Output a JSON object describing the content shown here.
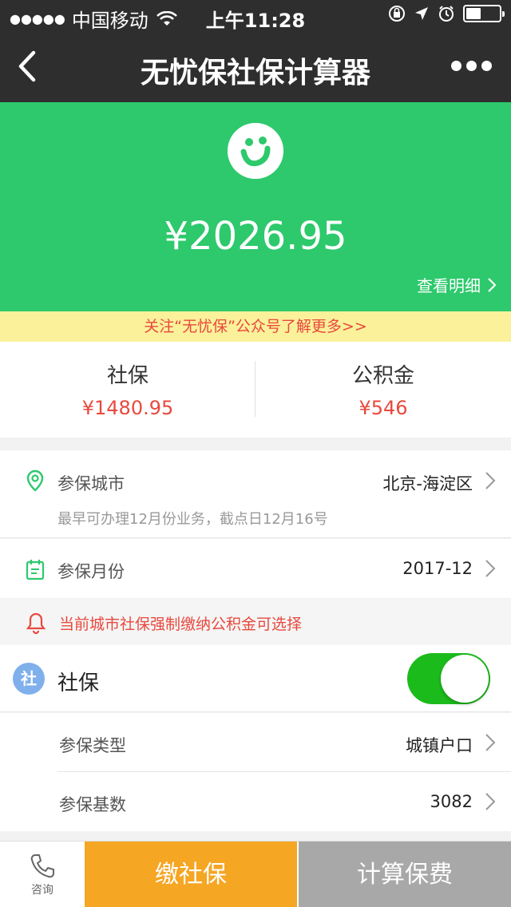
{
  "status_bar": {
    "signal": "●●●●●",
    "carrier": "中国移动",
    "time": "上午11:28"
  },
  "nav": {
    "title": "无忧保社保计算器"
  },
  "hero": {
    "amount": "¥2026.95",
    "detail_link": "查看明细"
  },
  "notice_banner": "关注“无忧保”公众号了解更多>>",
  "summary": {
    "social": {
      "label": "社保",
      "value": "¥1480.95"
    },
    "fund": {
      "label": "公积金",
      "value": "¥546"
    }
  },
  "city": {
    "label": "参保城市",
    "value": "北京-海淀区",
    "note": "最早可办理12月份业务，截点日12月16号"
  },
  "month": {
    "label": "参保月份",
    "value": "2017-12"
  },
  "alert": "当前城市社保强制缴纳公积金可选择",
  "social_section": {
    "badge": "社",
    "label": "社保",
    "enabled": true
  },
  "insurance_type": {
    "label": "参保类型",
    "value": "城镇户口"
  },
  "insurance_base": {
    "label": "参保基数",
    "value": "3082"
  },
  "bottom": {
    "consult_label": "咨询",
    "pay_label": "缴社保",
    "calc_label": "计算保费"
  },
  "colors": {
    "brand_green": "#2dc96c",
    "alert_red": "#e8493e",
    "pay_orange": "#f5a623",
    "toggle_green": "#1cbb1c"
  },
  "icons": {
    "back": "chevron-left-icon",
    "more": "more-dots-icon",
    "location": "location-pin-icon",
    "calendar": "calendar-icon",
    "bell": "bell-icon",
    "phone": "phone-icon",
    "logo": "wuyoubao-logo"
  }
}
